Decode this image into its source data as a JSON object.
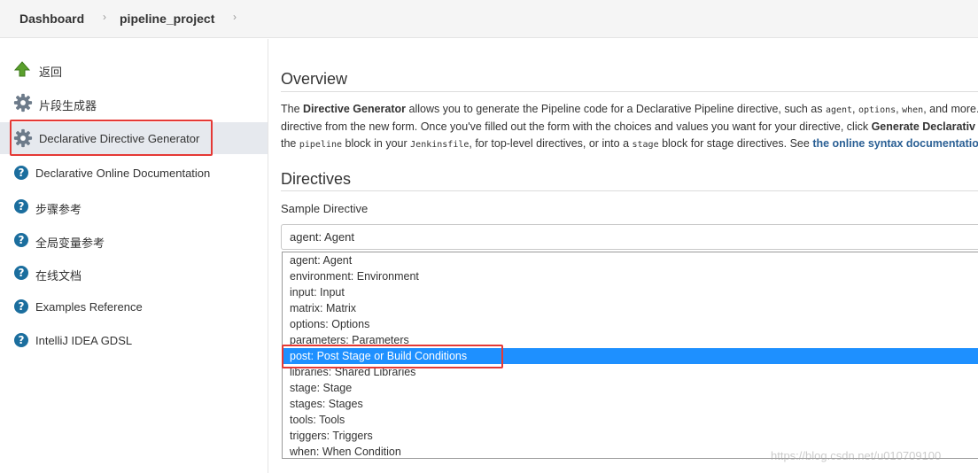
{
  "breadcrumb": {
    "items": [
      "Dashboard",
      "pipeline_project"
    ],
    "separator": "›"
  },
  "sidebar": {
    "items": [
      {
        "label": "返回",
        "icon": "up-arrow-icon"
      },
      {
        "label": "片段生成器",
        "icon": "gear-icon"
      },
      {
        "label": "Declarative Directive Generator",
        "icon": "gear-icon",
        "active": true
      },
      {
        "label": "Declarative Online Documentation",
        "icon": "help-icon"
      },
      {
        "label": "步骤参考",
        "icon": "help-icon"
      },
      {
        "label": "全局变量参考",
        "icon": "help-icon"
      },
      {
        "label": "在线文档",
        "icon": "help-icon"
      },
      {
        "label": "Examples Reference",
        "icon": "help-icon"
      },
      {
        "label": "IntelliJ IDEA GDSL",
        "icon": "help-icon"
      }
    ],
    "help_glyph": "?"
  },
  "overview": {
    "heading": "Overview",
    "line1": {
      "t1": "The ",
      "b1": "Directive Generator",
      "t2": " allows you to generate the Pipeline code for a Declarative Pipeline directive, such as ",
      "c1": "agent",
      "t3": ", ",
      "c2": "options",
      "t4": ", ",
      "c3": "when",
      "t5": ", and more. C"
    },
    "line2": {
      "t1": "directive from the new form. Once you've filled out the form with the choices and values you want for your directive, click ",
      "b1": "Generate Declarativ"
    },
    "line3": {
      "t1": "the ",
      "c1": "pipeline",
      "t2": " block in your ",
      "c2": "Jenkinsfile",
      "t3": ", for top-level directives, or into a ",
      "c3": "stage",
      "t4": " block for stage directives. See ",
      "link": "the online syntax documentation"
    }
  },
  "directives": {
    "heading": "Directives",
    "field_label": "Sample Directive",
    "selected_value": "agent: Agent",
    "options": [
      "agent: Agent",
      "environment: Environment",
      "input: Input",
      "matrix: Matrix",
      "options: Options",
      "parameters: Parameters",
      "post: Post Stage or Build Conditions",
      "libraries: Shared Libraries",
      "stage: Stage",
      "stages: Stages",
      "tools: Tools",
      "triggers: Triggers",
      "when: When Condition"
    ],
    "highlighted_option": "post: Post Stage or Build Conditions"
  },
  "watermark": "https://blog.csdn.net/u010709100",
  "colors": {
    "accent": "#1e90ff",
    "link": "#2a5f94",
    "annotation": "#e53935",
    "help_icon": "#1b6e9e"
  }
}
